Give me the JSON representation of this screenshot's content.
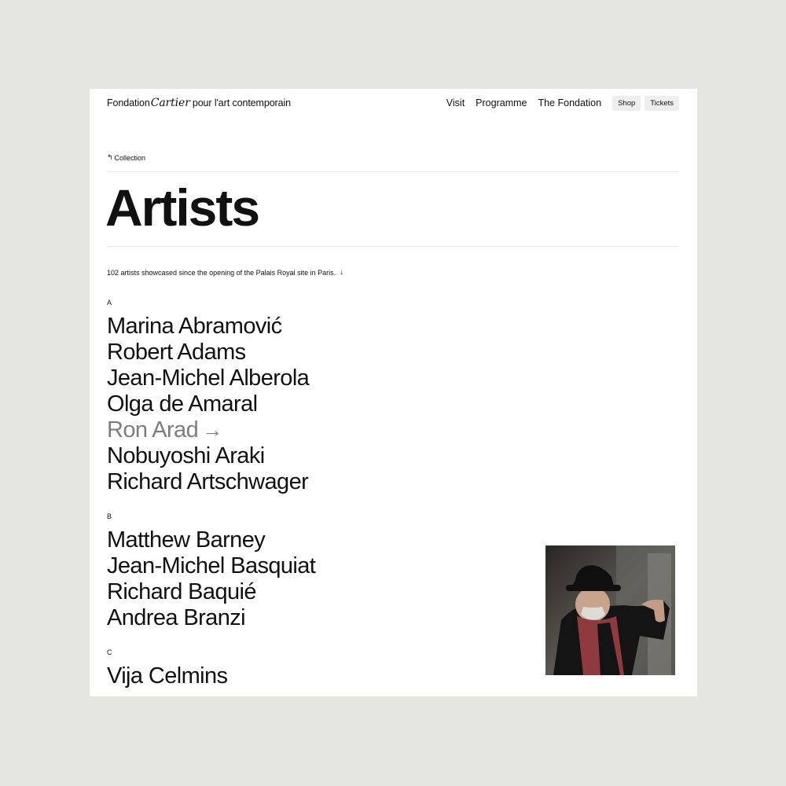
{
  "header": {
    "logo_left": "Fondation",
    "logo_script": "Cartier",
    "logo_right": "pour l'art contemporain",
    "nav": [
      "Visit",
      "Programme",
      "The Fondation"
    ],
    "shop": "Shop",
    "tickets": "Tickets"
  },
  "breadcrumb": {
    "icon": "arrow-up-left-icon",
    "label": "Collection"
  },
  "page_title": "Artists",
  "intro": {
    "text": "102 artists showcased since the opening of the Palais Royal site in Paris.",
    "icon": "arrow-down-icon"
  },
  "sections": [
    {
      "letter": "A",
      "names": [
        "Marina Abramović",
        "Robert Adams",
        "Jean-Michel Alberola",
        "Olga de Amaral",
        "Ron Arad",
        "Nobuyoshi Araki",
        "Richard Artschwager"
      ]
    },
    {
      "letter": "B",
      "names": [
        "Matthew Barney",
        "Jean-Michel Basquiat",
        "Richard Baquié",
        "Andrea Branzi"
      ]
    },
    {
      "letter": "C",
      "names": [
        "Vija Celmins"
      ]
    }
  ],
  "hovered_artist": "Ron Arad",
  "hover_arrow": "→",
  "hover_image": "portrait of artist in black hat and red scarf",
  "colors": {
    "page_bg": "#e6e6e1",
    "card_bg": "#ffffff",
    "text": "#111111",
    "hover_text": "#7d7d7d",
    "pill_bg": "#eeeeee"
  }
}
